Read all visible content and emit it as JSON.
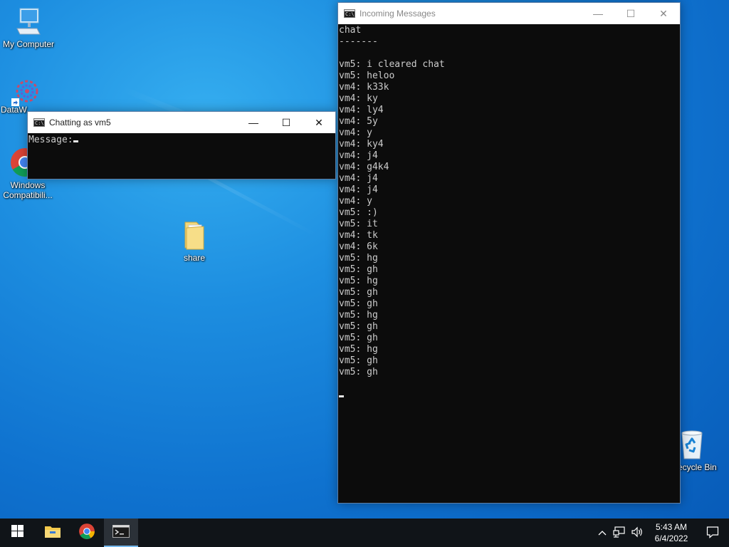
{
  "desktop": {
    "icons": [
      {
        "label": "My Computer"
      },
      {
        "label": "DataW"
      },
      {
        "label": "Windows Compatibili..."
      },
      {
        "label": "share"
      },
      {
        "label": "ecycle Bin"
      }
    ]
  },
  "windows": {
    "incoming": {
      "title": "Incoming Messages",
      "lines": [
        "chat",
        "-------",
        "",
        "vm5: i cleared chat",
        "vm5: heloo",
        "vm4: k33k",
        "vm4: ky",
        "vm4: ly4",
        "vm4: 5y",
        "vm4: y",
        "vm4: ky4",
        "vm4: j4",
        "vm4: g4k4",
        "vm4: j4",
        "vm4: j4",
        "vm4: y",
        "vm5: :)",
        "vm5: it",
        "vm4: tk",
        "vm4: 6k",
        "vm5: hg",
        "vm5: gh",
        "vm5: hg",
        "vm5: gh",
        "vm5: gh",
        "vm5: hg",
        "vm5: gh",
        "vm5: gh",
        "vm5: hg",
        "vm5: gh",
        "vm5: gh"
      ]
    },
    "chat": {
      "title": "Chatting as vm5",
      "prompt": "Message:"
    },
    "controls": {
      "minimize": "—",
      "maximize": "☐",
      "close": "✕"
    }
  },
  "taskbar": {
    "time": "5:43 AM",
    "date": "6/4/2022"
  },
  "colors": {
    "desktop_blue": "#0f72cf",
    "console_bg": "#0c0c0c",
    "console_text": "#cccccc",
    "taskbar_bg": "#101418",
    "taskbar_accent": "#76b9ed"
  }
}
